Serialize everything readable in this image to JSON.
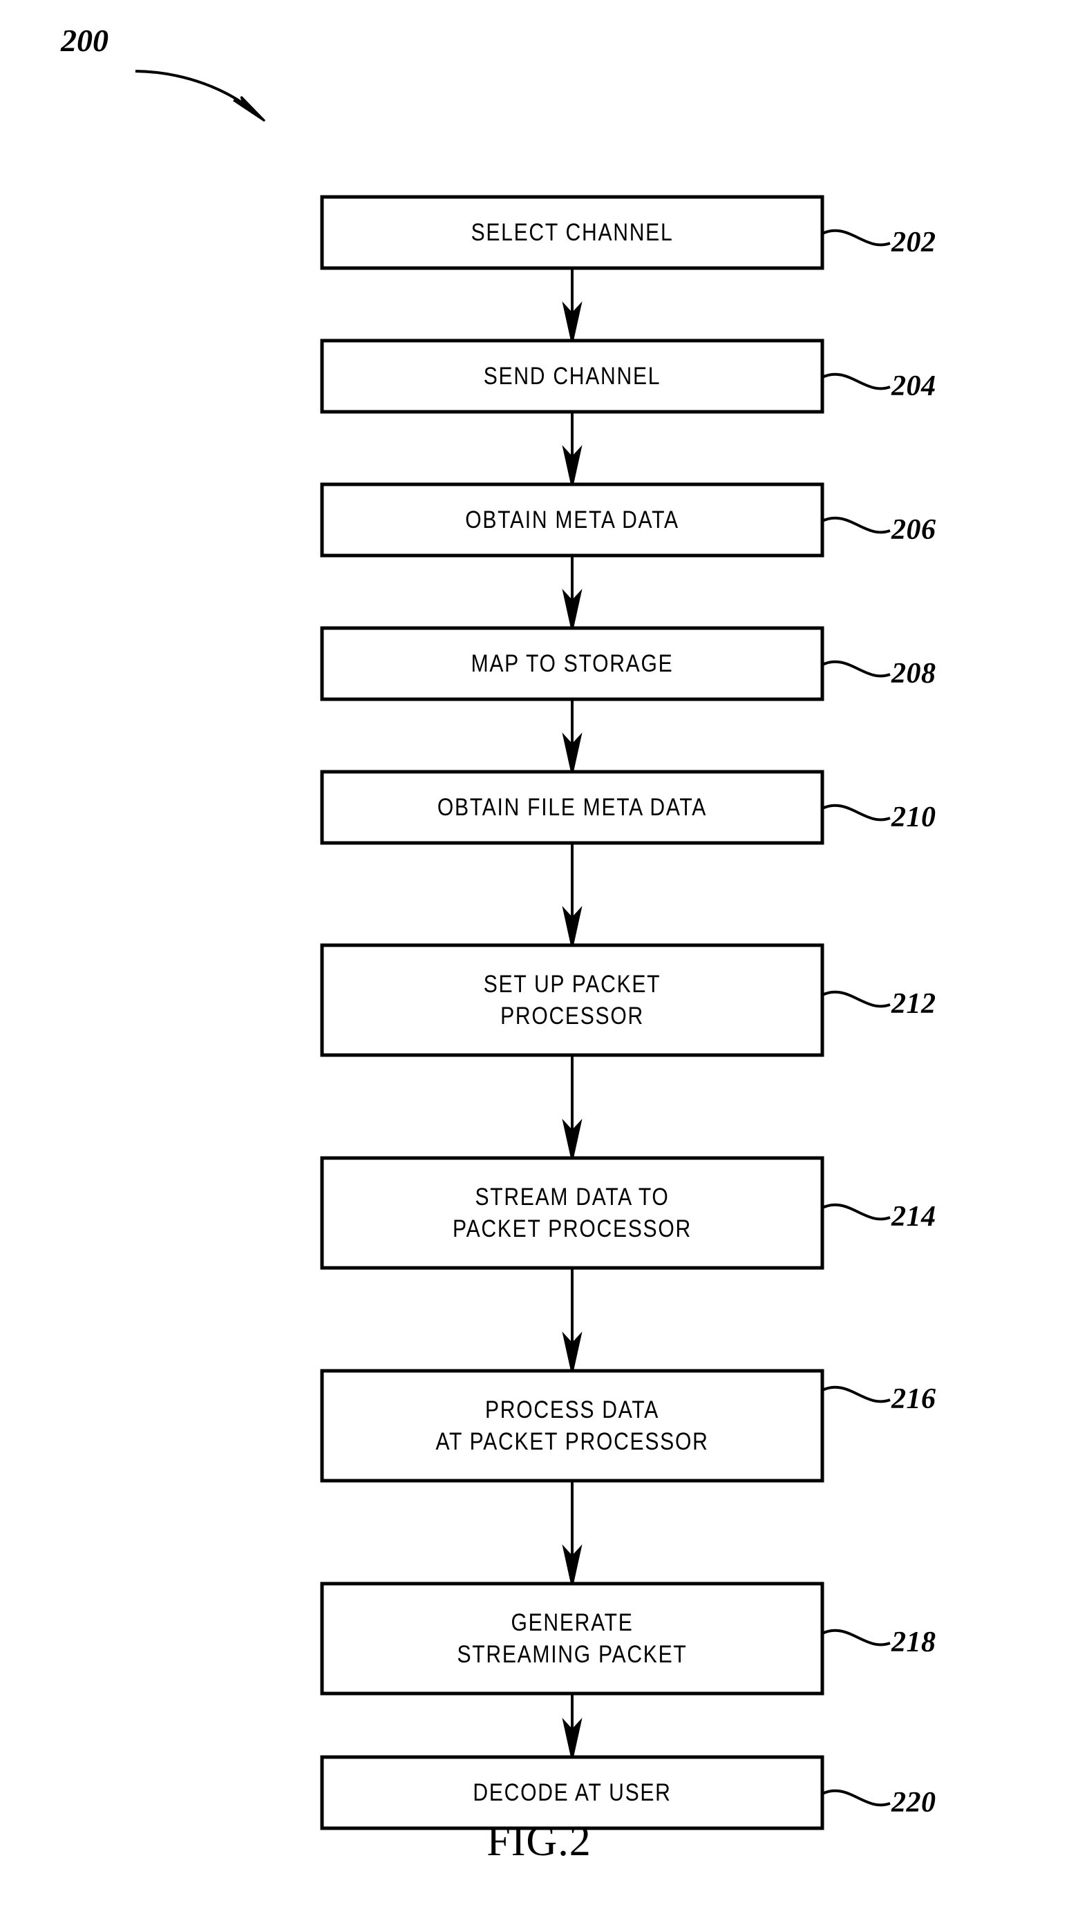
{
  "figure": {
    "diagram_ref": "200",
    "caption": "FIG.2",
    "title": "Flowchart of streaming media process"
  },
  "steps": [
    {
      "ref": "202",
      "lines": [
        "SELECT  CHANNEL"
      ],
      "name": "select-channel"
    },
    {
      "ref": "204",
      "lines": [
        "SEND  CHANNEL"
      ],
      "name": "send-channel"
    },
    {
      "ref": "206",
      "lines": [
        "OBTAIN  META  DATA"
      ],
      "name": "obtain-meta-data"
    },
    {
      "ref": "208",
      "lines": [
        "MAP  TO  STORAGE"
      ],
      "name": "map-to-storage"
    },
    {
      "ref": "210",
      "lines": [
        "OBTAIN  FILE  META  DATA"
      ],
      "name": "obtain-file-meta-data"
    },
    {
      "ref": "212",
      "lines": [
        "SET  UP  PACKET",
        "PROCESSOR"
      ],
      "name": "set-up-packet-processor"
    },
    {
      "ref": "214",
      "lines": [
        "STREAM  DATA  TO",
        "PACKET  PROCESSOR"
      ],
      "name": "stream-data-to-packet-processor"
    },
    {
      "ref": "216",
      "lines": [
        "PROCESS  DATA",
        "AT  PACKET  PROCESSOR"
      ],
      "name": "process-data-at-packet-processor"
    },
    {
      "ref": "218",
      "lines": [
        "GENERATE",
        "STREAMING  PACKET"
      ],
      "name": "generate-streaming-packet"
    },
    {
      "ref": "220",
      "lines": [
        "DECODE  AT  USER"
      ],
      "name": "decode-at-user"
    }
  ],
  "colors": {
    "ink": "#000000",
    "paper": "#ffffff"
  }
}
